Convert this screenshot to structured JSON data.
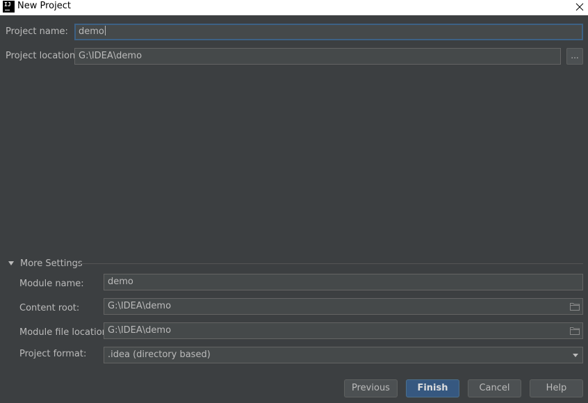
{
  "window": {
    "title": "New Project",
    "app_icon_text": "IJ"
  },
  "form": {
    "project_name_label": "Project name:",
    "project_name_value": "demo",
    "project_location_label": "Project location:",
    "project_location_value": "G:\\IDEA\\demo",
    "browse_label": "..."
  },
  "more_settings": {
    "title": "More Settings",
    "expanded": true,
    "module_name_label": "Module name:",
    "module_name_value": "demo",
    "content_root_label": "Content root:",
    "content_root_value": "G:\\IDEA\\demo",
    "module_file_location_label": "Module file location:",
    "module_file_location_value": "G:\\IDEA\\demo",
    "project_format_label": "Project format:",
    "project_format_value": ".idea (directory based)"
  },
  "buttons": {
    "previous": "Previous",
    "finish": "Finish",
    "cancel": "Cancel",
    "help": "Help"
  },
  "icons": {
    "close": "close-icon",
    "folder": "folder-icon",
    "expand": "triangle-down-icon",
    "dropdown": "chevron-down-icon"
  },
  "colors": {
    "background": "#3c3f41",
    "field_background": "#45494a",
    "focus_border": "#3d6185",
    "primary_button": "#365880",
    "text": "#bbbbbb"
  }
}
